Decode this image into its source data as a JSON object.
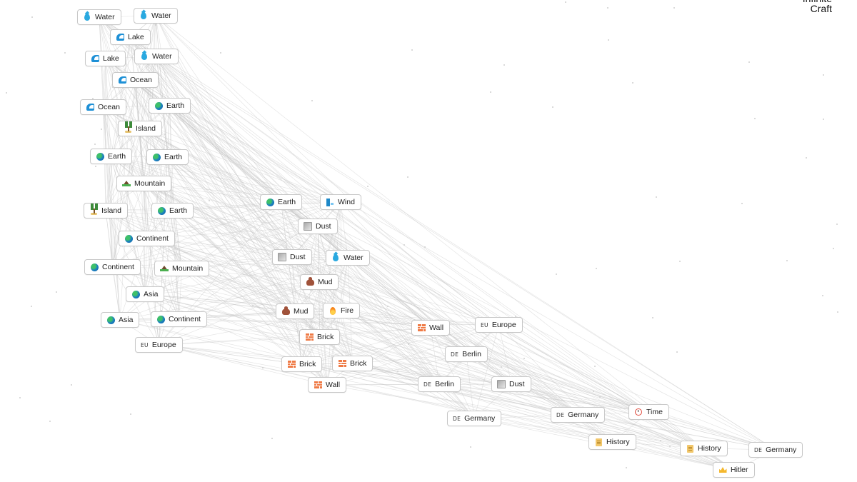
{
  "app": {
    "logo_line1": "Infinite",
    "logo_line2": "Craft"
  },
  "items": [
    {
      "id": "water1",
      "label": "Water",
      "icon": "droplet-icon"
    },
    {
      "id": "water2",
      "label": "Water",
      "icon": "droplet-icon"
    },
    {
      "id": "lake1",
      "label": "Lake",
      "icon": "wave-icon"
    },
    {
      "id": "lake2",
      "label": "Lake",
      "icon": "wave-icon"
    },
    {
      "id": "water3",
      "label": "Water",
      "icon": "droplet-icon"
    },
    {
      "id": "ocean1",
      "label": "Ocean",
      "icon": "wave-icon"
    },
    {
      "id": "ocean2",
      "label": "Ocean",
      "icon": "wave-icon"
    },
    {
      "id": "earth1",
      "label": "Earth",
      "icon": "globe-icon"
    },
    {
      "id": "island1",
      "label": "Island",
      "icon": "island-icon"
    },
    {
      "id": "earth2",
      "label": "Earth",
      "icon": "globe-icon"
    },
    {
      "id": "earth3",
      "label": "Earth",
      "icon": "globe-icon"
    },
    {
      "id": "mountain1",
      "label": "Mountain",
      "icon": "mountain-icon"
    },
    {
      "id": "island2",
      "label": "Island",
      "icon": "island-icon"
    },
    {
      "id": "earth4",
      "label": "Earth",
      "icon": "globe-icon"
    },
    {
      "id": "continent1",
      "label": "Continent",
      "icon": "globe-icon"
    },
    {
      "id": "continent2",
      "label": "Continent",
      "icon": "globe-icon"
    },
    {
      "id": "mountain2",
      "label": "Mountain",
      "icon": "mountain-icon"
    },
    {
      "id": "asia1",
      "label": "Asia",
      "icon": "globe-icon"
    },
    {
      "id": "asia2",
      "label": "Asia",
      "icon": "globe-icon"
    },
    {
      "id": "continent3",
      "label": "Continent",
      "icon": "globe-icon"
    },
    {
      "id": "europe1",
      "label": "Europe",
      "icon": "eu-flag-icon",
      "flag": "EU"
    },
    {
      "id": "earth5",
      "label": "Earth",
      "icon": "globe-icon"
    },
    {
      "id": "wind1",
      "label": "Wind",
      "icon": "wind-icon"
    },
    {
      "id": "dust1",
      "label": "Dust",
      "icon": "dust-icon"
    },
    {
      "id": "dust2",
      "label": "Dust",
      "icon": "dust-icon"
    },
    {
      "id": "water4",
      "label": "Water",
      "icon": "droplet-icon"
    },
    {
      "id": "mud1",
      "label": "Mud",
      "icon": "mud-icon"
    },
    {
      "id": "mud2",
      "label": "Mud",
      "icon": "mud-icon"
    },
    {
      "id": "fire1",
      "label": "Fire",
      "icon": "fire-icon"
    },
    {
      "id": "brick1",
      "label": "Brick",
      "icon": "brick-icon"
    },
    {
      "id": "brick2",
      "label": "Brick",
      "icon": "brick-icon"
    },
    {
      "id": "brick3",
      "label": "Brick",
      "icon": "brick-icon"
    },
    {
      "id": "wall1",
      "label": "Wall",
      "icon": "brick-icon"
    },
    {
      "id": "wall2",
      "label": "Wall",
      "icon": "brick-icon"
    },
    {
      "id": "europe2",
      "label": "Europe",
      "icon": "eu-flag-icon",
      "flag": "EU"
    },
    {
      "id": "berlin1",
      "label": "Berlin",
      "icon": "de-flag-icon",
      "flag": "DE"
    },
    {
      "id": "berlin2",
      "label": "Berlin",
      "icon": "de-flag-icon",
      "flag": "DE"
    },
    {
      "id": "dust3",
      "label": "Dust",
      "icon": "dust-icon"
    },
    {
      "id": "germany1",
      "label": "Germany",
      "icon": "de-flag-icon",
      "flag": "DE"
    },
    {
      "id": "germany2",
      "label": "Germany",
      "icon": "de-flag-icon",
      "flag": "DE"
    },
    {
      "id": "time1",
      "label": "Time",
      "icon": "alarm-clock-icon"
    },
    {
      "id": "history1",
      "label": "History",
      "icon": "scroll-icon"
    },
    {
      "id": "history2",
      "label": "History",
      "icon": "scroll-icon"
    },
    {
      "id": "germany3",
      "label": "Germany",
      "icon": "de-flag-icon",
      "flag": "DE"
    },
    {
      "id": "hitler1",
      "label": "Hitler",
      "icon": "crown-icon"
    }
  ]
}
